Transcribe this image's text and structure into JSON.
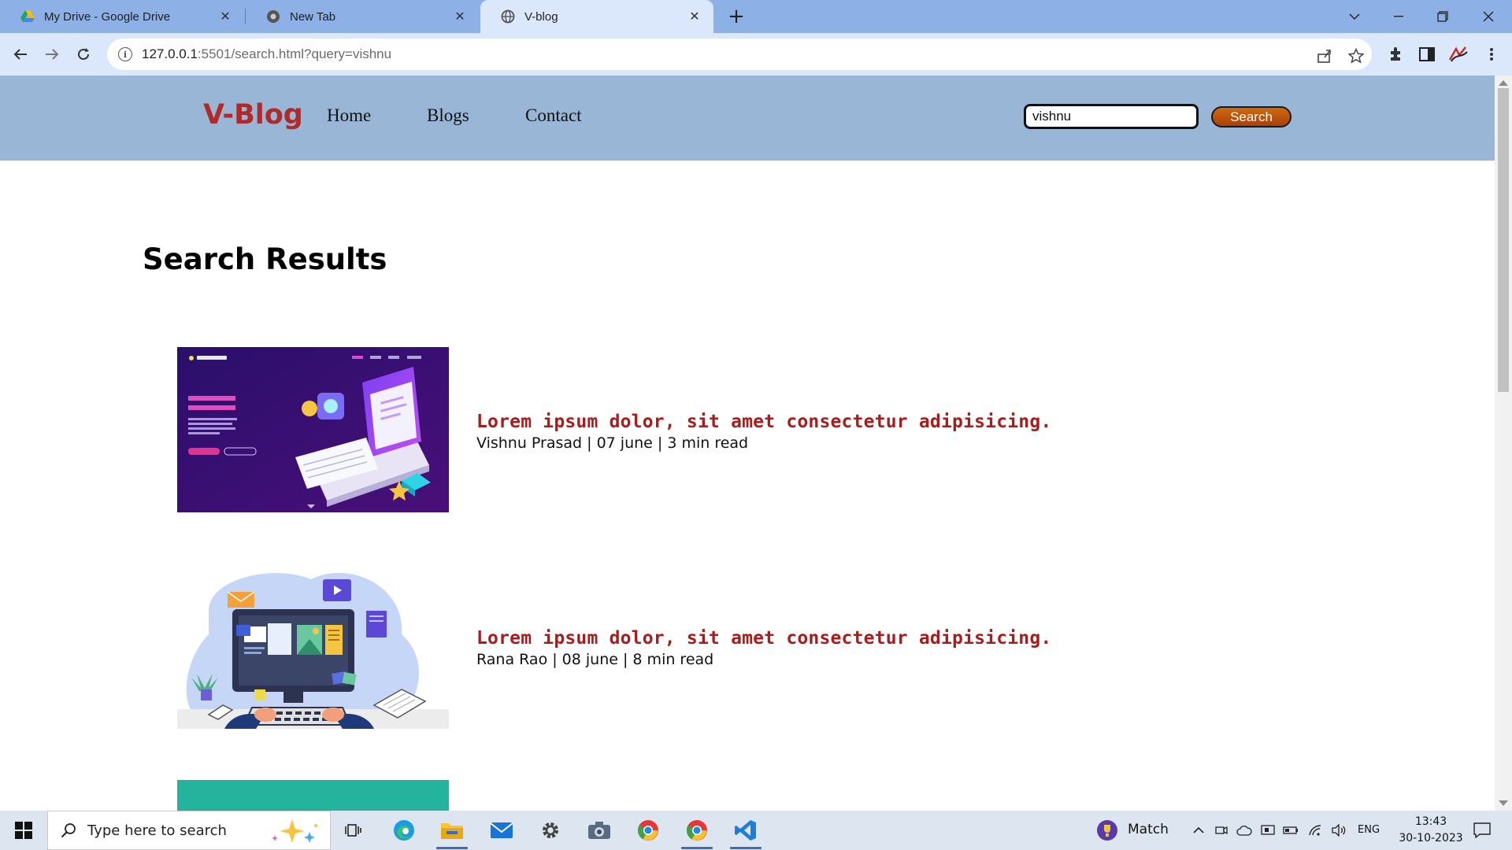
{
  "browser": {
    "tabs": [
      {
        "title": "My Drive - Google Drive",
        "icon": "google-drive-icon",
        "active": false
      },
      {
        "title": "New Tab",
        "icon": "chrome-icon",
        "active": false
      },
      {
        "title": "V-blog",
        "icon": "globe-icon",
        "active": true
      }
    ],
    "address": {
      "host": "127.0.0.1",
      "rest": ":5501/search.html?query=vishnu"
    }
  },
  "site": {
    "logo": "V-Blog",
    "nav": [
      "Home",
      "Blogs",
      "Contact"
    ],
    "search": {
      "value": "vishnu",
      "button": "Search"
    },
    "heading": "Search Results",
    "results": [
      {
        "title": "Lorem ipsum dolor, sit amet consectetur adipisicing.",
        "meta": "Vishnu Prasad | 07 june | 3 min read",
        "image": "isometric-laptop-illustration"
      },
      {
        "title": "Lorem ipsum dolor, sit amet consectetur adipisicing.",
        "meta": "Rana Rao | 08 june | 8 min read",
        "image": "desktop-workspace-illustration"
      }
    ],
    "colors": {
      "header_bg": "#99b6d6",
      "logo": "#b02a2a",
      "result_title": "#a91c1c",
      "button": "#c25a0d"
    }
  },
  "taskbar": {
    "search_placeholder": "Type here to search",
    "weather_label": "Match",
    "language": "ENG",
    "time": "13:43",
    "date": "30-10-2023"
  }
}
